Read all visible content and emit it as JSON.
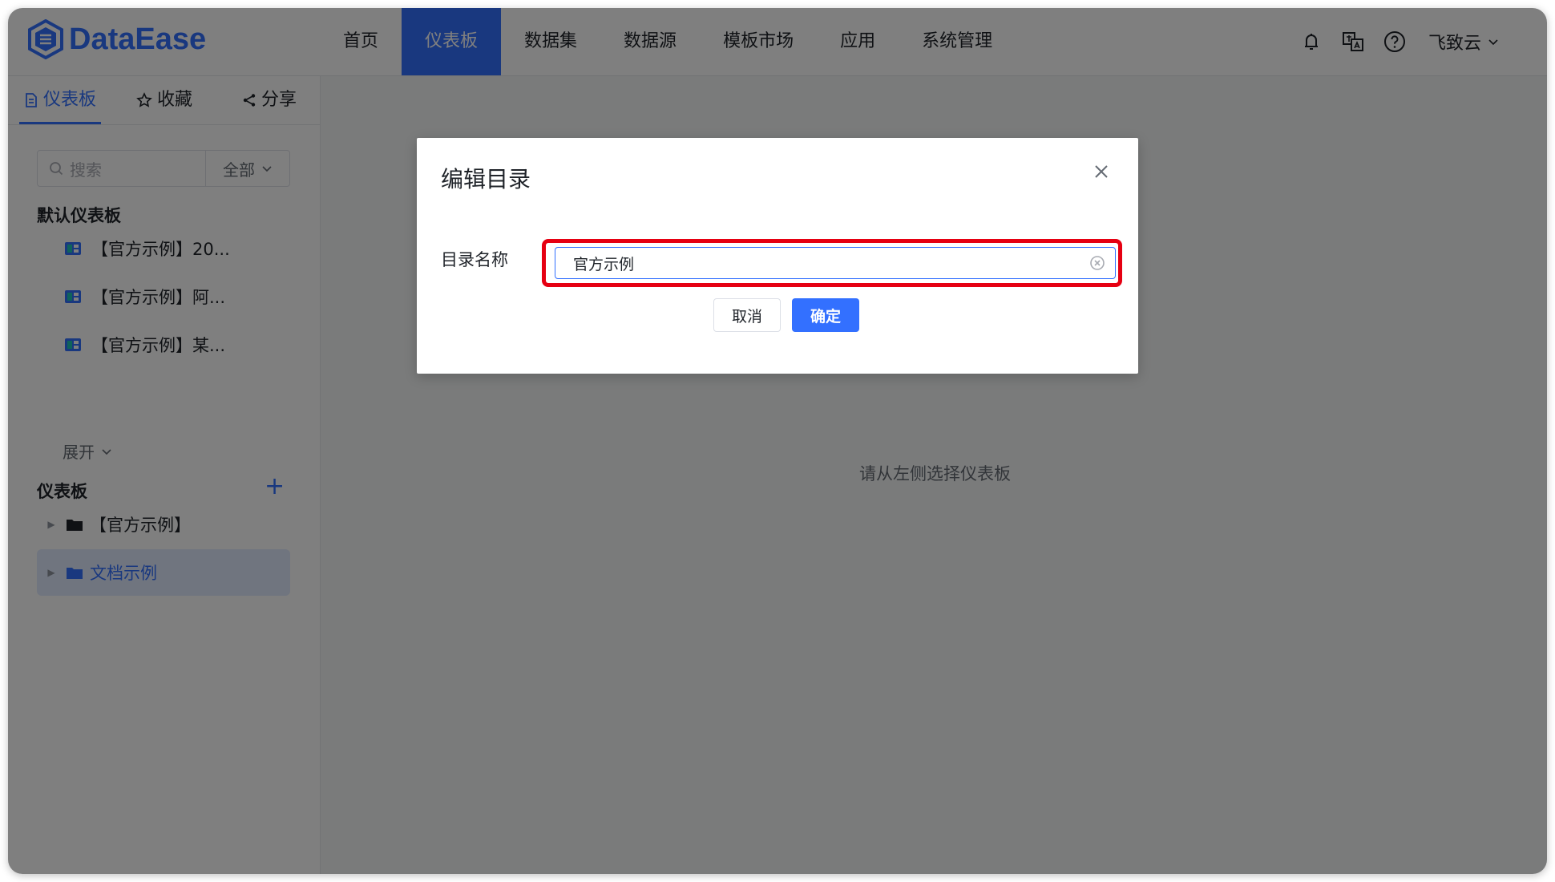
{
  "app": {
    "logo_text": "DataEase"
  },
  "nav": {
    "items": [
      {
        "label": "首页"
      },
      {
        "label": "仪表板"
      },
      {
        "label": "数据集"
      },
      {
        "label": "数据源"
      },
      {
        "label": "模板市场"
      },
      {
        "label": "应用"
      },
      {
        "label": "系统管理"
      }
    ],
    "active_index": 1
  },
  "header": {
    "user_name": "飞致云"
  },
  "sidebar": {
    "tabs": [
      {
        "label": "仪表板",
        "icon": "document-icon"
      },
      {
        "label": "收藏",
        "icon": "star-icon"
      },
      {
        "label": "分享",
        "icon": "share-icon"
      }
    ],
    "search": {
      "placeholder": "搜索",
      "filter_value": "全部"
    },
    "default_section": {
      "title": "默认仪表板",
      "items": [
        {
          "label": "【官方示例】20..."
        },
        {
          "label": "【官方示例】阿..."
        },
        {
          "label": "【官方示例】某..."
        }
      ],
      "expand_label": "展开"
    },
    "dashboard_section": {
      "title": "仪表板",
      "tree": [
        {
          "label": "【官方示例】"
        },
        {
          "label": "文档示例"
        }
      ]
    }
  },
  "main": {
    "empty_text": "请从左侧选择仪表板"
  },
  "dialog": {
    "title": "编辑目录",
    "field_label": "目录名称",
    "input_value": "官方示例",
    "cancel_label": "取消",
    "confirm_label": "确定"
  },
  "colors": {
    "accent": "#3370ff",
    "highlight": "#e60012"
  }
}
